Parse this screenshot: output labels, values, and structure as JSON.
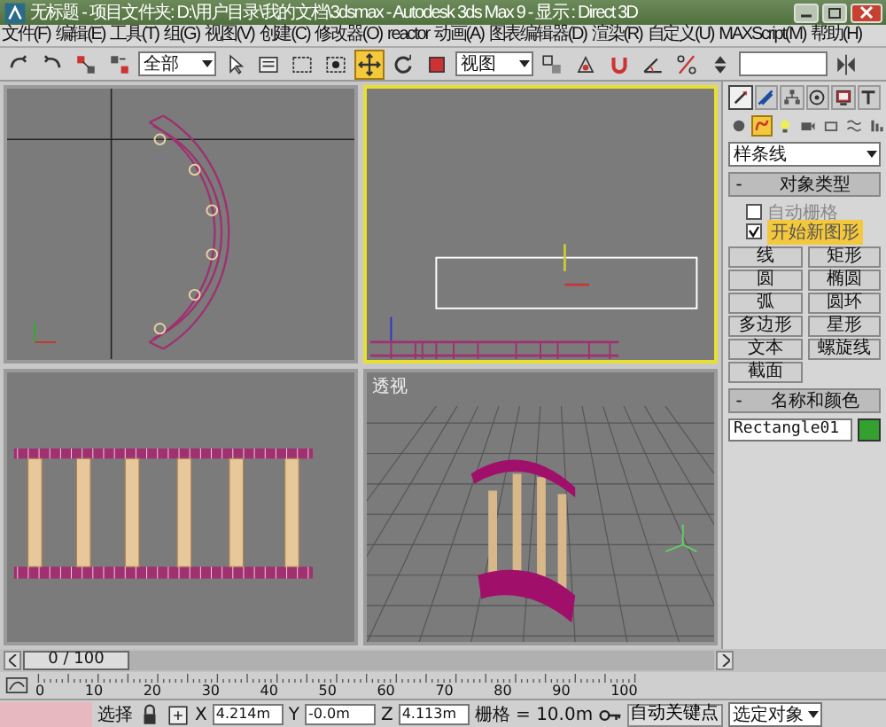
{
  "window": {
    "title": "无标题 - 项目文件夹: D:\\用户目录\\我的文档\\3dsmax - Autodesk 3ds Max 9 - 显示 : Direct 3D"
  },
  "menu": [
    "文件(F)",
    "编辑(E)",
    "工具(T)",
    "组(G)",
    "视图(V)",
    "创建(C)",
    "修改器(O)",
    "reactor",
    "动画(A)",
    "图表编辑器(D)",
    "渲染(R)",
    "自定义(U)",
    "MAXScript(M)",
    "帮助(H)"
  ],
  "toolbar": [
    {
      "kind": "undo",
      "selected": false
    },
    {
      "kind": "redo",
      "selected": false
    },
    {
      "kind": "link",
      "selected": false
    },
    {
      "kind": "unlink",
      "selected": false
    },
    {
      "kind": "dropdown",
      "value": "全部"
    },
    {
      "kind": "select",
      "selected": false
    },
    {
      "kind": "list",
      "selected": false
    },
    {
      "kind": "region",
      "selected": false
    },
    {
      "kind": "crossing",
      "selected": false
    },
    {
      "kind": "move",
      "selected": true
    },
    {
      "kind": "rotate",
      "selected": false
    },
    {
      "kind": "scale",
      "selected": false
    },
    {
      "kind": "dropdown",
      "value": "视图"
    },
    {
      "kind": "pivot",
      "selected": false
    },
    {
      "kind": "manipulate",
      "selected": false
    },
    {
      "kind": "snap",
      "selected": false
    },
    {
      "kind": "angle",
      "selected": false
    },
    {
      "kind": "percent",
      "selected": false
    },
    {
      "kind": "spinner",
      "selected": false
    },
    {
      "kind": "field"
    },
    {
      "kind": "mirror",
      "selected": false
    }
  ],
  "viewports": [
    {
      "kind": "top",
      "active": false
    },
    {
      "kind": "front",
      "active": true
    },
    {
      "kind": "left",
      "active": false
    },
    {
      "kind": "perspective",
      "active": false,
      "label": "透视"
    }
  ],
  "command_panel": {
    "tabs": [
      {
        "kind": "create",
        "selected": true
      },
      {
        "kind": "modify",
        "selected": false
      },
      {
        "kind": "hierarchy",
        "selected": false
      },
      {
        "kind": "motion",
        "selected": false
      },
      {
        "kind": "display",
        "selected": false
      },
      {
        "kind": "utilities",
        "selected": false
      }
    ],
    "categories": [
      {
        "kind": "geometry",
        "selected": false
      },
      {
        "kind": "shapes",
        "selected": true
      },
      {
        "kind": "lights",
        "selected": false
      },
      {
        "kind": "cameras",
        "selected": false
      },
      {
        "kind": "helpers",
        "selected": false
      },
      {
        "kind": "spacewarps",
        "selected": false
      },
      {
        "kind": "systems",
        "selected": false
      }
    ],
    "dropdown": "样条线",
    "object_type": {
      "collapse_sign": "-",
      "title": "对象类型",
      "options": [
        {
          "label": "自动栅格",
          "checked": false
        },
        {
          "label": "开始新图形",
          "checked": true
        }
      ],
      "buttons": [
        "线",
        "矩形",
        "圆",
        "椭圆",
        "弧",
        "圆环",
        "多边形",
        "星形",
        "文本",
        "螺旋线",
        "截面"
      ]
    },
    "name_color": {
      "collapse_sign": "-",
      "title": "名称和颜色",
      "name": "Rectangle01"
    }
  },
  "time_slider": {
    "reading": "0 / 100",
    "level": 0,
    "ticks": [
      "0",
      "10",
      "20",
      "30",
      "40",
      "50",
      "60",
      "70",
      "80",
      "90",
      "100"
    ]
  },
  "status": {
    "selection": "选择",
    "coords": [
      {
        "axis": "X",
        "value": "4.214m"
      },
      {
        "axis": "Y",
        "value": "-0.0m"
      },
      {
        "axis": "Z",
        "value": "4.113m"
      }
    ],
    "grid": "栅格 = 10.0m",
    "auto_key": "自动关键点",
    "key_mode": "选定对象"
  }
}
